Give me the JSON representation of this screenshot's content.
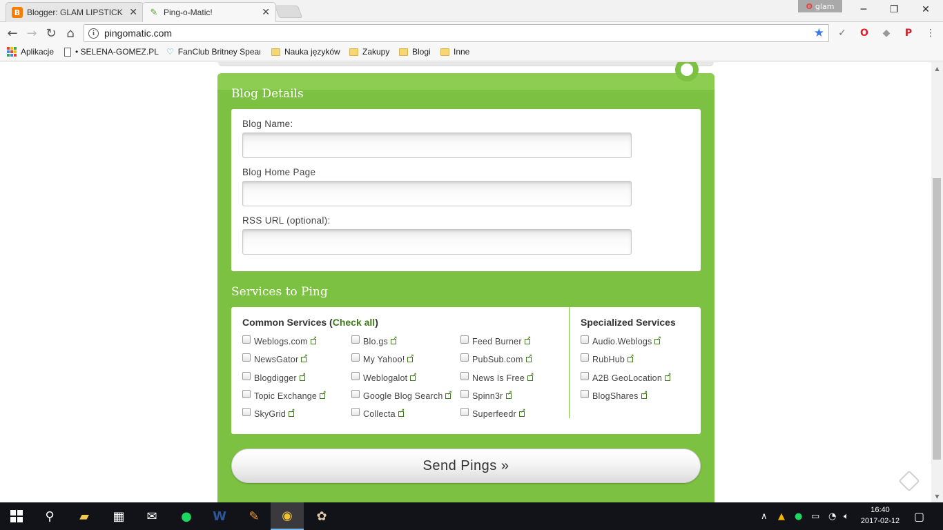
{
  "browser": {
    "tabs": [
      {
        "title": "Blogger: GLAM LIPSTICK",
        "icon": "blogger-icon",
        "active": false
      },
      {
        "title": "Ping-o-Matic!",
        "icon": "pingomatic-icon",
        "active": true
      }
    ],
    "profile_name": "glam",
    "url": "pingomatic.com",
    "bookmarks": [
      {
        "label": "Aplikacje"
      },
      {
        "label": "• SELENA-GOMEZ.PL"
      },
      {
        "label": "FanClub Britney Spear"
      },
      {
        "label": "Nauka języków"
      },
      {
        "label": "Zakupy"
      },
      {
        "label": "Blogi"
      },
      {
        "label": "Inne"
      }
    ]
  },
  "blog_details": {
    "title": "Blog Details",
    "fields": [
      {
        "label": "Blog Name:",
        "value": ""
      },
      {
        "label": "Blog Home Page",
        "value": ""
      },
      {
        "label": "RSS URL (optional):",
        "value": ""
      }
    ]
  },
  "services": {
    "title": "Services to Ping",
    "common_heading": "Common Services (",
    "check_all": "Check all",
    "common_heading_end": ")",
    "specialized_heading": "Specialized Services",
    "common": [
      [
        "Weblogs.com",
        "Blo.gs",
        "Feed Burner"
      ],
      [
        "NewsGator",
        "My Yahoo!",
        "PubSub.com"
      ],
      [
        "Blogdigger",
        "Weblogalot",
        "News Is Free"
      ],
      [
        "Topic Exchange",
        "Google Blog Search",
        "Spinn3r"
      ],
      [
        "SkyGrid",
        "Collecta",
        "Superfeedr"
      ]
    ],
    "specialized": [
      "Audio.Weblogs",
      "RubHub",
      "A2B GeoLocation",
      "BlogShares"
    ]
  },
  "send_button": "Send Pings »",
  "taskbar": {
    "time": "16:40",
    "date": "2017-02-12"
  },
  "colors": {
    "panel_green": "#7dc142",
    "link_green": "#3e7a18",
    "taskbar": "#121318"
  }
}
